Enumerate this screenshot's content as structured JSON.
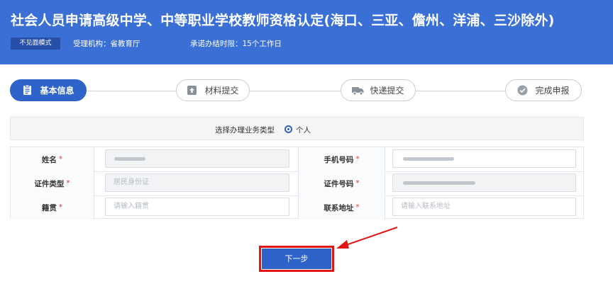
{
  "header": {
    "title": "社会人员申请高级中学、中等职业学校教师资格认定(海口、三亚、儋州、洋浦、三沙除外)",
    "mode_badge": "不见面模式",
    "agency": "受理机构：省教育厅",
    "deadline": "承诺办结时限：15个工作日"
  },
  "steps": [
    {
      "label": "基本信息",
      "icon": "document-icon",
      "active": true
    },
    {
      "label": "材料提交",
      "icon": "upload-icon",
      "active": false
    },
    {
      "label": "快递提交",
      "icon": "truck-icon",
      "active": false
    },
    {
      "label": "完成申报",
      "icon": "check-circle-icon",
      "active": false
    }
  ],
  "business_type": {
    "label": "选择办理业务类型",
    "option": "个人",
    "selected": true
  },
  "form": {
    "name_label": "姓名",
    "phone_label": "手机号码",
    "id_type_label": "证件类型",
    "id_type_value": "居民身份证",
    "id_number_label": "证件号码",
    "native_place_label": "籍贯",
    "native_place_placeholder": "请输入籍贯",
    "address_label": "联系地址",
    "address_placeholder": "请输入联系地址",
    "required_mark": "*"
  },
  "actions": {
    "next_label": "下一步"
  },
  "colors": {
    "header_bg": "#3a6fd6",
    "primary": "#2e64c9",
    "annotation_red": "#e01616",
    "required_red": "#e23a3a"
  }
}
